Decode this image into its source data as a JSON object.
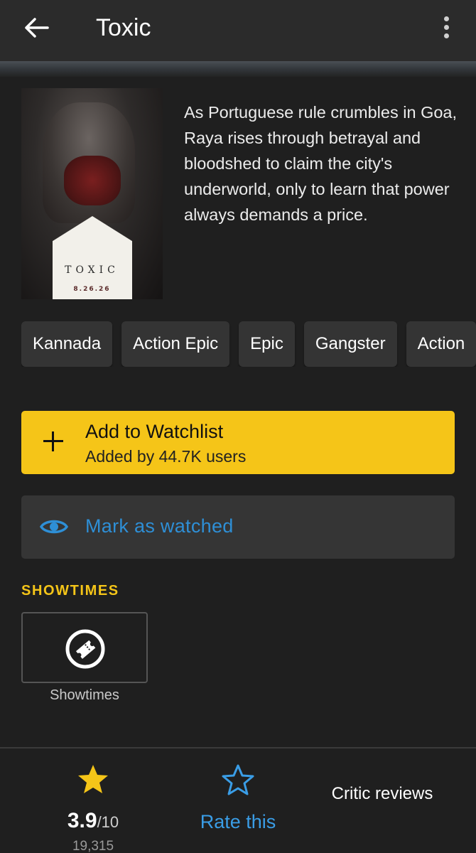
{
  "header": {
    "title": "Toxic",
    "back_icon": "arrow-left-icon",
    "more_icon": "more-vertical-icon"
  },
  "poster": {
    "title_text": "TOXIC",
    "date_text": "8.26.26"
  },
  "synopsis": "As Portuguese rule crumbles in Goa, Raya rises through betrayal and bloodshed to claim the city's underworld, only to learn that power always demands a price.",
  "genres": [
    "Kannada",
    "Action Epic",
    "Epic",
    "Gangster",
    "Action"
  ],
  "watchlist": {
    "label": "Add to Watchlist",
    "sublabel": "Added by 44.7K users",
    "color": "#f5c518"
  },
  "watched": {
    "label": "Mark as watched",
    "color": "#2e8fd6"
  },
  "showtimes": {
    "section_label": "SHOWTIMES",
    "tile_label": "Showtimes"
  },
  "bottom": {
    "rating": "3.9",
    "rating_scale": "/10",
    "rating_count": "19,315",
    "rate_label": "Rate this",
    "critic_label": "Critic reviews"
  }
}
